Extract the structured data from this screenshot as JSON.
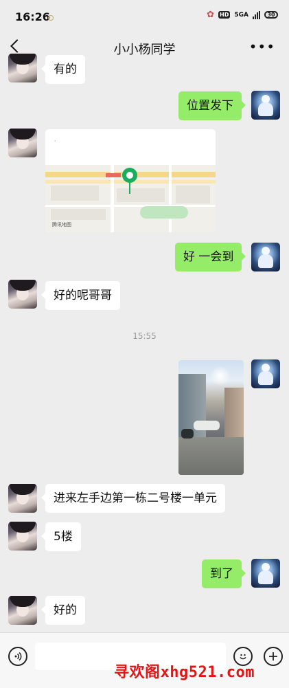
{
  "status_bar": {
    "time": "16:26",
    "network": "5GA",
    "hd_label": "HD",
    "battery": "30"
  },
  "header": {
    "title": "小小杨同学",
    "more": "•••"
  },
  "messages": {
    "m1": "有的",
    "m2": "位置发下",
    "m4": "好 一会到",
    "m5": "好的呢哥哥",
    "timestamp": "15:55",
    "m7": "进来左手边第一栋二号楼一单元",
    "m8": "5楼",
    "m9": "到了",
    "m10": "好的"
  },
  "location": {
    "title": "·",
    "map_source": "腾讯地图"
  },
  "input": {
    "watermark": "寻欢阁xhg521.com"
  },
  "icons": {
    "back": "chevron-left-icon",
    "more": "more-dots-icon",
    "voice": "voice-icon",
    "emoji": "emoji-icon",
    "plus": "plus-icon"
  },
  "colors": {
    "outgoing_bubble": "#95ec69",
    "incoming_bubble": "#ffffff",
    "background": "#ededed",
    "pin": "#1aad5e",
    "watermark": "#e31414"
  }
}
